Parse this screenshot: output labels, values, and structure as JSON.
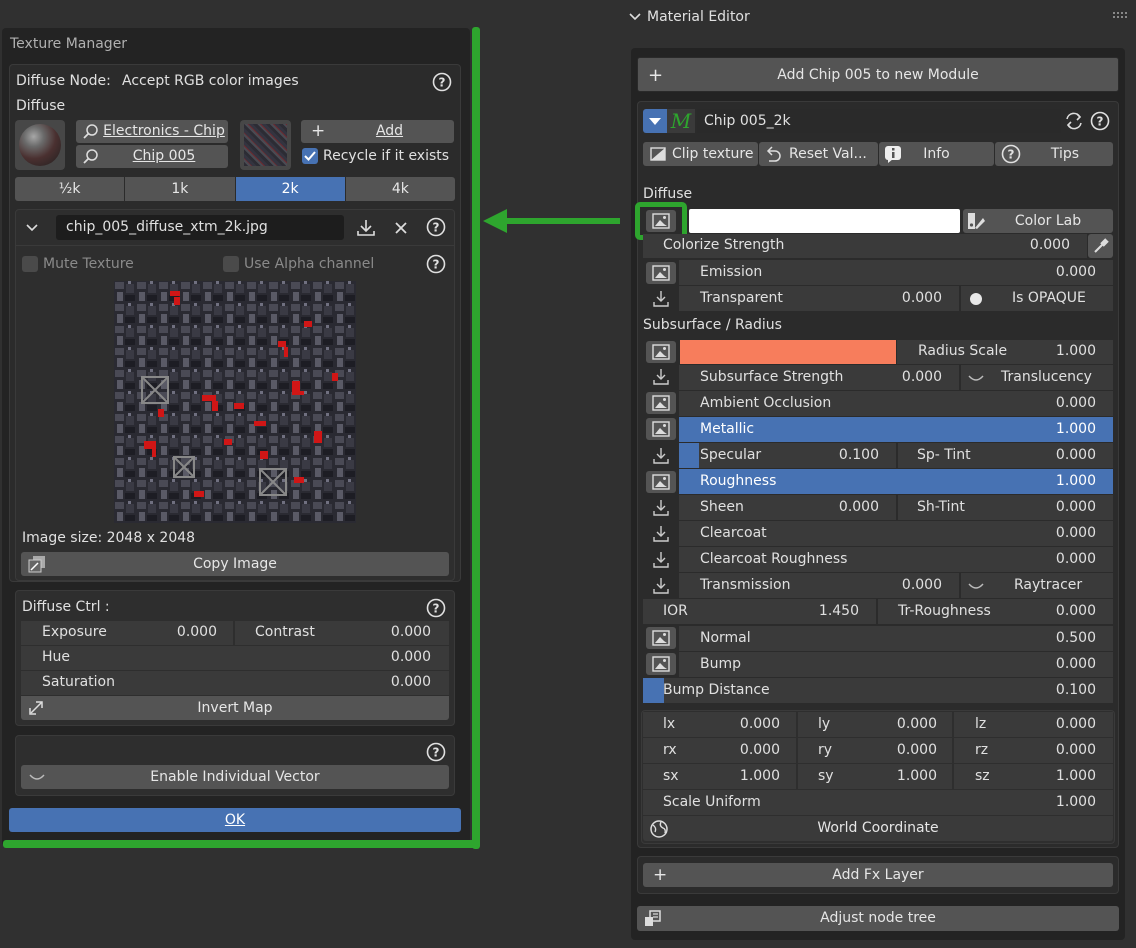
{
  "texture_manager": {
    "title": "Texture Manager",
    "node_label": "Diffuse Node:",
    "node_hint": "Accept RGB color images",
    "section": "Diffuse",
    "search_category": "Electronics - Chip",
    "search_name": "Chip 005",
    "add_label": "Add",
    "recycle_label": "Recycle if it exists",
    "res_tabs": [
      "½k",
      "1k",
      "2k",
      "4k"
    ],
    "res_active": "2k",
    "filename": "chip_005_diffuse_xtm_2k.jpg",
    "mute_label": "Mute Texture",
    "alpha_label": "Use Alpha channel",
    "image_size": "Image size: 2048 x 2048",
    "copy_label": "Copy Image",
    "ctrl_title": "Diffuse Ctrl :",
    "exposure_label": "Exposure",
    "exposure_value": "0.000",
    "contrast_label": "Contrast",
    "contrast_value": "0.000",
    "hue_label": "Hue",
    "hue_value": "0.000",
    "saturation_label": "Saturation",
    "saturation_value": "0.000",
    "invert_label": "Invert Map",
    "vector_label": "Enable Individual Vector",
    "ok_label": "OK"
  },
  "material_editor": {
    "title": "Material Editor",
    "add_module": "Add Chip 005 to new Module",
    "material_name": "Chip 005_2k",
    "clip_label": "Clip texture",
    "reset_label": "Reset Val...",
    "info_label": "Info",
    "tips_label": "Tips",
    "diffuse_section": "Diffuse",
    "color_lab": "Color Lab",
    "colorize_label": "Colorize Strength",
    "colorize_value": "0.000",
    "emission_label": "Emission",
    "emission_value": "0.000",
    "transparent_label": "Transparent",
    "transparent_value": "0.000",
    "opaque_label": "Is OPAQUE",
    "subsurface_section": "Subsurface / Radius",
    "radius_scale_label": "Radius Scale",
    "radius_scale_value": "1.000",
    "ss_strength_label": "Subsurface Strength",
    "ss_strength_value": "0.000",
    "translucency_label": "Translucency",
    "ao_label": "Ambient Occlusion",
    "ao_value": "0.000",
    "metallic_label": "Metallic",
    "metallic_value": "1.000",
    "specular_label": "Specular",
    "specular_value": "0.100",
    "sptint_label": "Sp- Tint",
    "sptint_value": "0.000",
    "roughness_label": "Roughness",
    "roughness_value": "1.000",
    "sheen_label": "Sheen",
    "sheen_value": "0.000",
    "shtint_label": "Sh-Tint",
    "shtint_value": "0.000",
    "clearcoat_label": "Clearcoat",
    "clearcoat_value": "0.000",
    "cc_rough_label": "Clearcoat Roughness",
    "cc_rough_value": "0.000",
    "transmission_label": "Transmission",
    "transmission_value": "0.000",
    "raytracer_label": "Raytracer",
    "ior_label": "IOR",
    "ior_value": "1.450",
    "tr_rough_label": "Tr-Roughness",
    "tr_rough_value": "0.000",
    "normal_label": "Normal",
    "normal_value": "0.500",
    "bump_label": "Bump",
    "bump_value": "0.000",
    "bump_dist_label": "Bump Distance",
    "bump_dist_value": "0.100",
    "lx_label": "lx",
    "lx_value": "0.000",
    "ly_label": "ly",
    "ly_value": "0.000",
    "lz_label": "lz",
    "lz_value": "0.000",
    "rx_label": "rx",
    "rx_value": "0.000",
    "ry_label": "ry",
    "ry_value": "0.000",
    "rz_label": "rz",
    "rz_value": "0.000",
    "sx_label": "sx",
    "sx_value": "1.000",
    "sy_label": "sy",
    "sy_value": "1.000",
    "sz_label": "sz",
    "sz_value": "1.000",
    "scale_uniform_label": "Scale Uniform",
    "scale_uniform_value": "1.000",
    "world_coord_label": "World Coordinate",
    "add_fx_label": "Add Fx Layer",
    "adjust_label": "Adjust node tree"
  },
  "colors": {
    "accent_blue": "#4772b3",
    "highlight_green": "#2ea52e",
    "radius_color": "#f77d5c",
    "diffuse_color": "#ffffff"
  }
}
